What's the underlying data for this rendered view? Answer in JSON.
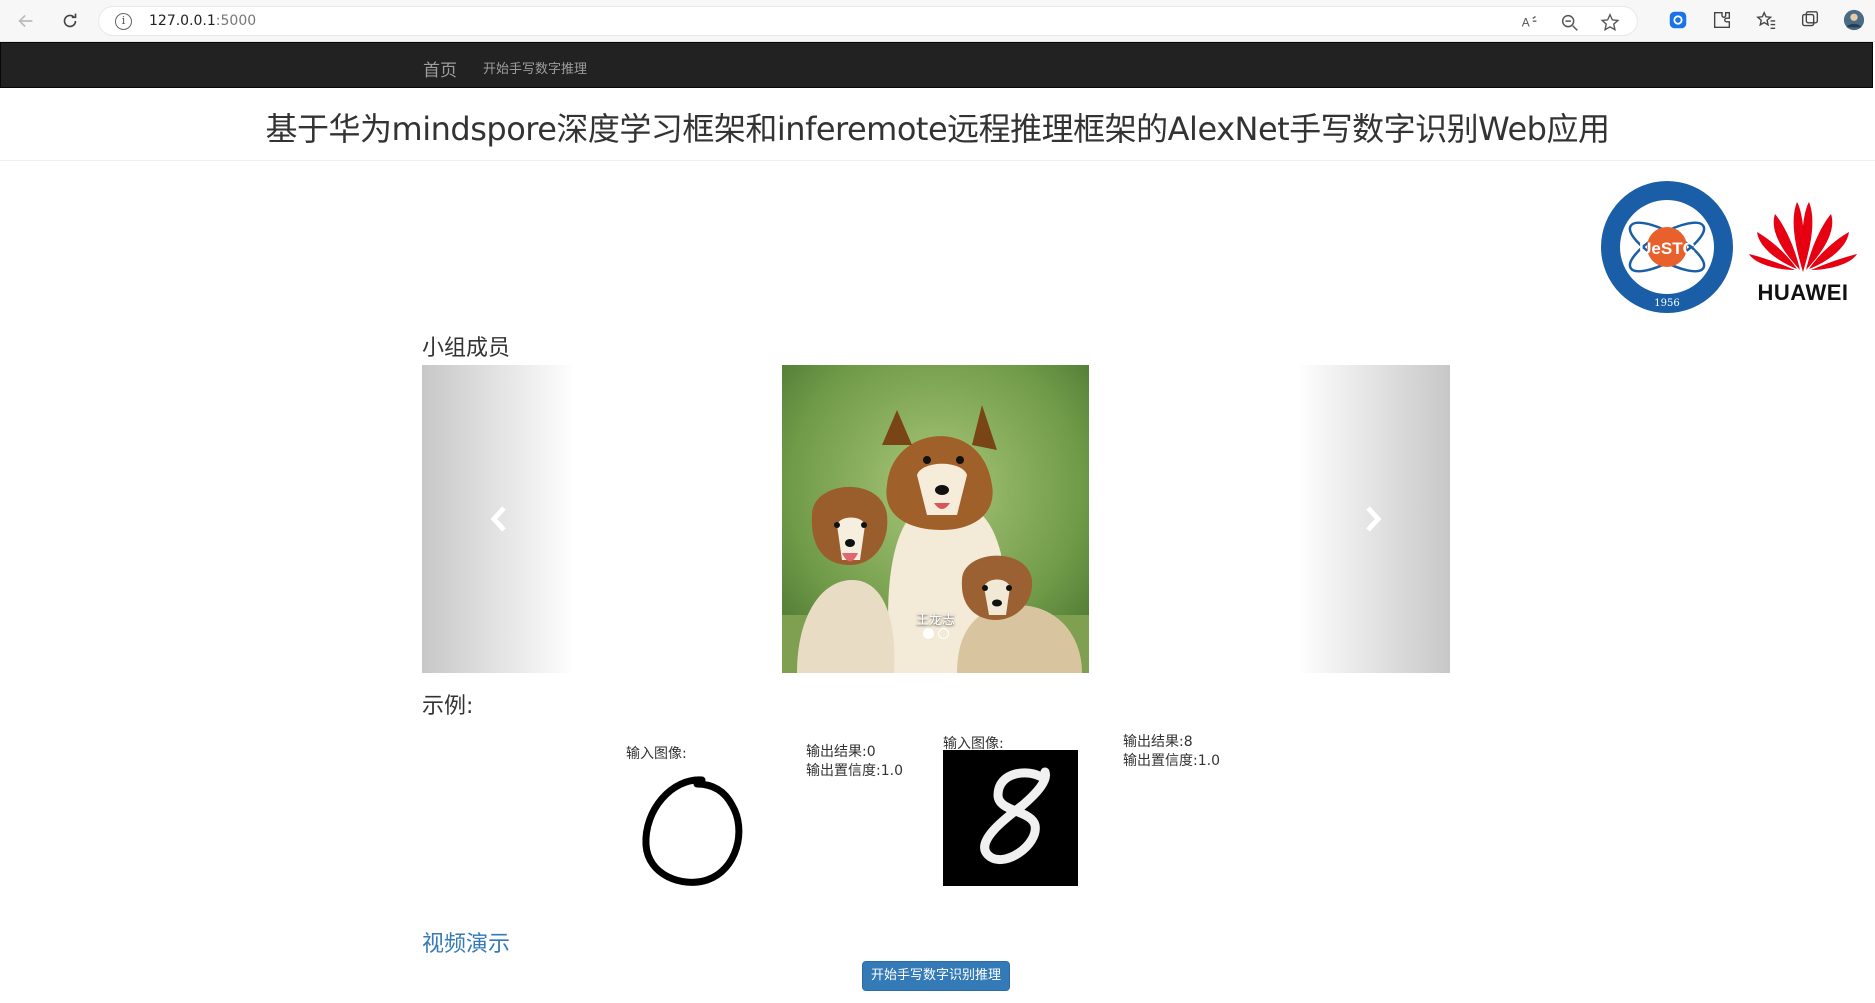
{
  "browser": {
    "url_host": "127.0.0.1",
    "url_port": ":5000"
  },
  "navbar": {
    "brand": "首页",
    "link": "开始手写数字推理"
  },
  "header": {
    "title": "基于华为mindspore深度学习框架和inferemote远程推理框架的AlexNet手写数字识别Web应用"
  },
  "logos": {
    "huawei_text": "HUAWEI"
  },
  "members": {
    "heading": "小组成员",
    "caption": "王龙志",
    "prev_icon": "chevron-left-icon",
    "next_icon": "chevron-right-icon",
    "active_index": 0,
    "total": 2
  },
  "examples": {
    "heading": "示例:",
    "items": [
      {
        "input_label": "输入图像:",
        "result_label": "输出结果:0",
        "confidence_label": "输出置信度:1.0"
      },
      {
        "input_label": "输入图像:",
        "result_label": "输出结果:8",
        "confidence_label": "输出置信度:1.0"
      }
    ]
  },
  "video": {
    "link": "视频演示"
  },
  "action": {
    "start_button": "开始手写数字识别推理"
  },
  "colors": {
    "navbar_bg": "#222222",
    "link_blue": "#337ab7",
    "button_blue": "#337ab7"
  }
}
